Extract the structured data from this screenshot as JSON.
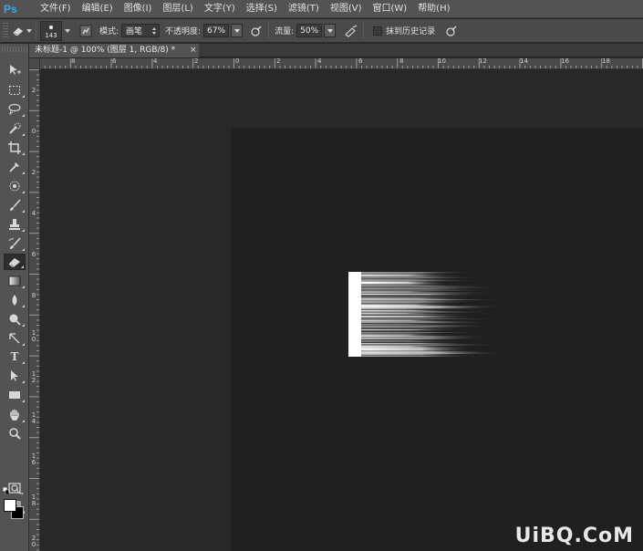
{
  "app": {
    "logo": "Ps"
  },
  "menu": [
    {
      "label": "文件(F)",
      "name": "menu-file"
    },
    {
      "label": "编辑(E)",
      "name": "menu-edit"
    },
    {
      "label": "图像(I)",
      "name": "menu-image"
    },
    {
      "label": "图层(L)",
      "name": "menu-layer"
    },
    {
      "label": "文字(Y)",
      "name": "menu-type"
    },
    {
      "label": "选择(S)",
      "name": "menu-select"
    },
    {
      "label": "滤镜(T)",
      "name": "menu-filter"
    },
    {
      "label": "视图(V)",
      "name": "menu-view"
    },
    {
      "label": "窗口(W)",
      "name": "menu-window"
    },
    {
      "label": "帮助(H)",
      "name": "menu-help"
    }
  ],
  "options": {
    "brush_size": "143",
    "mode_label": "模式:",
    "mode_value": "画笔",
    "opacity_label": "不透明度:",
    "opacity_value": "67%",
    "flow_label": "流量:",
    "flow_value": "50%",
    "erase_history_label": "抹到历史记录",
    "erase_history_checked": false
  },
  "document": {
    "tab_title": "未标题-1 @ 100% (图层 1, RGB/8) *",
    "close_glyph": "×"
  },
  "rulers": {
    "top_labels": [
      "8",
      "6",
      "4",
      "2",
      "0",
      "2",
      "4",
      "6",
      "8",
      "10",
      "12",
      "14",
      "16",
      "18"
    ],
    "left_labels": [
      "2",
      "0",
      "2",
      "4",
      "6",
      "8",
      "10",
      "12",
      "14",
      "16",
      "18",
      "20"
    ]
  },
  "tools": [
    {
      "name": "move-tool-icon",
      "active": false
    },
    {
      "name": "marquee-tool-icon",
      "active": false
    },
    {
      "name": "lasso-tool-icon",
      "active": false
    },
    {
      "name": "quick-select-tool-icon",
      "active": false
    },
    {
      "name": "crop-tool-icon",
      "active": false
    },
    {
      "name": "eyedropper-tool-icon",
      "active": false
    },
    {
      "name": "healing-brush-tool-icon",
      "active": false
    },
    {
      "name": "brush-tool-icon",
      "active": false
    },
    {
      "name": "clone-stamp-tool-icon",
      "active": false
    },
    {
      "name": "history-brush-tool-icon",
      "active": false
    },
    {
      "name": "eraser-tool-icon",
      "active": true
    },
    {
      "name": "gradient-tool-icon",
      "active": false
    },
    {
      "name": "blur-tool-icon",
      "active": false
    },
    {
      "name": "dodge-tool-icon",
      "active": false
    },
    {
      "name": "pen-tool-icon",
      "active": false
    },
    {
      "name": "type-tool-icon",
      "active": false,
      "glyph": "T"
    },
    {
      "name": "path-select-tool-icon",
      "active": false
    },
    {
      "name": "shape-tool-icon",
      "active": false
    },
    {
      "name": "hand-tool-icon",
      "active": false
    },
    {
      "name": "zoom-tool-icon",
      "active": false
    },
    {
      "name": "quick-mask-icon",
      "active": false
    },
    {
      "name": "screen-mode-icon",
      "active": false
    }
  ],
  "colors": {
    "foreground": "#ffffff",
    "background": "#000000",
    "accent": "#3aa8f0"
  },
  "watermark": "UiBQ.CoM"
}
